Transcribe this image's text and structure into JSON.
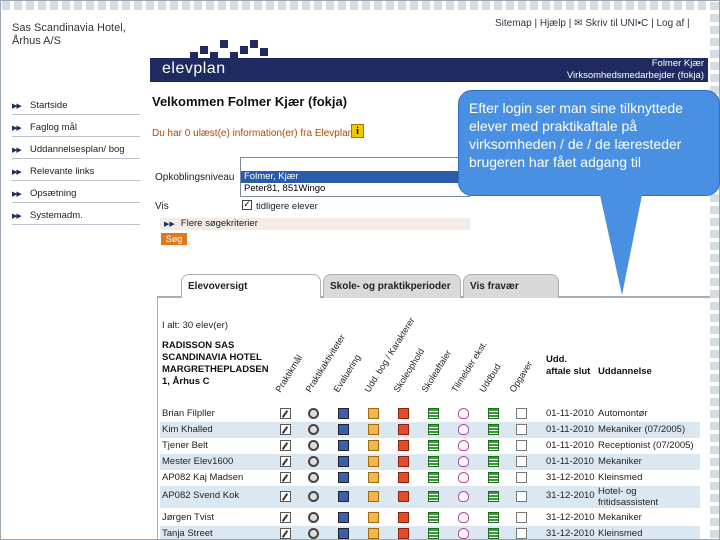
{
  "header": {
    "org_line1": "Sas Scandinavia Hotel,",
    "org_line2": "Århus A/S",
    "links": [
      "Sitemap",
      "Hjælp",
      "Skriv til UNI•C",
      "Log af"
    ],
    "logo_text": "elevplan",
    "user_name": "Folmer Kjær",
    "user_role": "Virksomhedsmedarbejder (fokja)"
  },
  "sidebar": {
    "items": [
      {
        "label": "Startside"
      },
      {
        "label": "Faglog mål"
      },
      {
        "label": "Uddannelsesplan/ bog"
      },
      {
        "label": "Relevante links"
      },
      {
        "label": "Opsætning"
      },
      {
        "label": "Systemadm."
      }
    ]
  },
  "main": {
    "welcome": "Velkommen Folmer Kjær (fokja)",
    "unread": "Du har 0 ulæst(e) information(er) fra Elevplan",
    "connection_label": "Opkoblingsniveau",
    "connection_options": [
      "Folmer, Kjær",
      "Peter81, 851Wingo"
    ],
    "show_label": "Vis",
    "show_previous_label": "tidligere elever",
    "more_criteria": "Flere søgekriterier",
    "search_button": "Søg"
  },
  "callout": {
    "text": "Efter login ser man sine tilknyttede elever med praktikaftale på virksomheden / de / de læresteder brugeren har fået adgang til"
  },
  "tabs": [
    {
      "label": "Elevoversigt",
      "active": true
    },
    {
      "label": "Skole- og praktikperioder",
      "active": false
    },
    {
      "label": "Vis fravær",
      "active": false
    }
  ],
  "table": {
    "count_text": "I alt: 30 elev(er)",
    "company_line1": "RADISSON SAS",
    "company_line2": "SCANDINAVIA HOTEL",
    "company_line3": "MARGRETHEPLADSEN",
    "company_line4": "1, Århus C",
    "rotated_headers": [
      "Praktikmål",
      "Praktikaktiviteter",
      "Evaluering",
      "Udd. bog / Karakterer",
      "Skoleophold",
      "Skoleaftaler",
      "Tilmelder ekst.",
      "Uddbud",
      "Opgaver"
    ],
    "udd_header_line1": "Udd.",
    "udd_header_line2": "aftale slut",
    "uddannelse_header": "Uddannelse",
    "rows": [
      {
        "name": "Brian Filpller",
        "date": "01-11-2010",
        "education": "Automontør"
      },
      {
        "name": "Kim Khalled",
        "date": "01-11-2010",
        "education": "Mekaniker (07/2005)"
      },
      {
        "name": "Tjener Belt",
        "date": "01-11-2010",
        "education": "Receptionist (07/2005)"
      },
      {
        "name": "Mester Elev1600",
        "date": "01-11-2010",
        "education": "Mekaniker"
      },
      {
        "name": "AP082 Kaj Madsen",
        "date": "31-12-2010",
        "education": "Kleinsmed"
      },
      {
        "name": "AP082 Svend Kok",
        "date": "31-12-2010",
        "education": "Hotel- og fritidsassistent"
      },
      {
        "name": "Jørgen Tvist",
        "date": "31-12-2010",
        "education": "Mekaniker"
      },
      {
        "name": "Tanja Street",
        "date": "31-12-2010",
        "education": "Kleinsmed"
      }
    ]
  }
}
